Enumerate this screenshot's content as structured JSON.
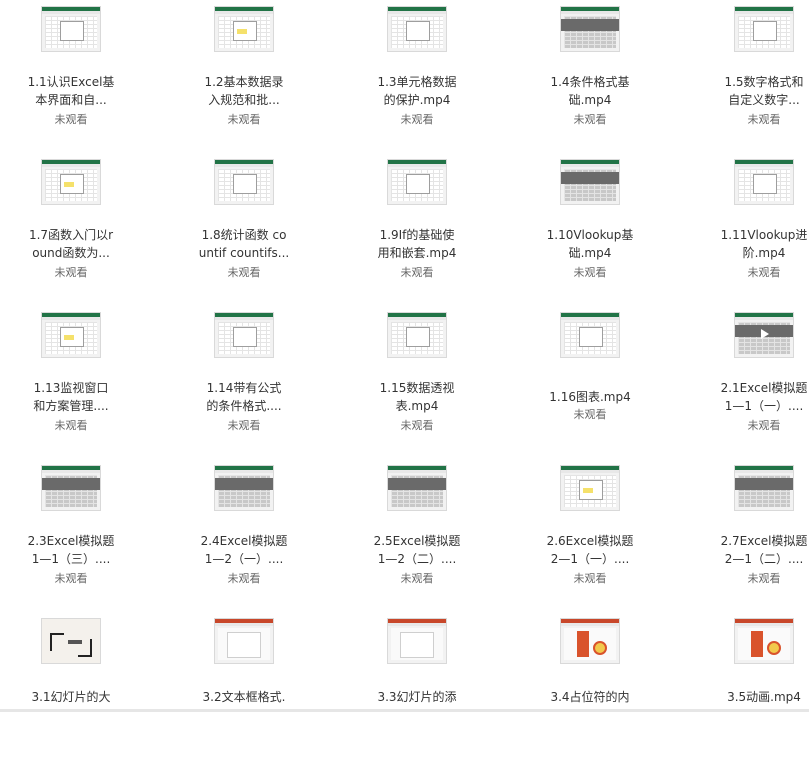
{
  "videos": [
    {
      "title": "1.1认识Excel基\n本界面和自...",
      "status": "未观看",
      "thumb": "excel-dialog"
    },
    {
      "title": "1.2基本数据录\n入规范和批...",
      "status": "未观看",
      "thumb": "excel-highlight"
    },
    {
      "title": "1.3单元格数据\n的保护.mp4",
      "status": "未观看",
      "thumb": "excel-dialog"
    },
    {
      "title": "1.4条件格式基\n础.mp4",
      "status": "未观看",
      "thumb": "excel-dark"
    },
    {
      "title": "1.5数字格式和\n自定义数字...",
      "status": "未观看",
      "thumb": "excel-dialog"
    },
    {
      "title": "1.7函数入门以r\nound函数为...",
      "status": "未观看",
      "thumb": "excel-highlight"
    },
    {
      "title": "1.8统计函数 co\nuntif countifs...",
      "status": "未观看",
      "thumb": "excel-dialog"
    },
    {
      "title": "1.9If的基础使\n用和嵌套.mp4",
      "status": "未观看",
      "thumb": "excel-dialog"
    },
    {
      "title": "1.10Vlookup基\n础.mp4",
      "status": "未观看",
      "thumb": "excel-dark"
    },
    {
      "title": "1.11Vlookup进\n阶.mp4",
      "status": "未观看",
      "thumb": "excel-dialog"
    },
    {
      "title": "1.13监视窗口\n和方案管理....",
      "status": "未观看",
      "thumb": "excel-highlight"
    },
    {
      "title": "1.14带有公式\n的条件格式....",
      "status": "未观看",
      "thumb": "excel-dialog"
    },
    {
      "title": "1.15数据透视\n表.mp4",
      "status": "未观看",
      "thumb": "excel-dialog"
    },
    {
      "title": "1.16图表.mp4",
      "status": "未观看",
      "thumb": "excel-dialog"
    },
    {
      "title": "2.1Excel模拟题\n1—1（一）....",
      "status": "未观看",
      "thumb": "excel-dark-play"
    },
    {
      "title": "2.3Excel模拟题\n1—1（三）....",
      "status": "未观看",
      "thumb": "excel-dark"
    },
    {
      "title": "2.4Excel模拟题\n1—2（一）....",
      "status": "未观看",
      "thumb": "excel-dark"
    },
    {
      "title": "2.5Excel模拟题\n1—2（二）....",
      "status": "未观看",
      "thumb": "excel-dark"
    },
    {
      "title": "2.6Excel模拟题\n2—1（一）....",
      "status": "未观看",
      "thumb": "excel-highlight"
    },
    {
      "title": "2.7Excel模拟题\n2—1（二）....",
      "status": "未观看",
      "thumb": "excel-dark"
    },
    {
      "title": "3.1幻灯片的大",
      "status": "",
      "thumb": "ppt-title"
    },
    {
      "title": "3.2文本框格式.",
      "status": "",
      "thumb": "ppt"
    },
    {
      "title": "3.3幻灯片的添",
      "status": "",
      "thumb": "ppt"
    },
    {
      "title": "3.4占位符的内",
      "status": "",
      "thumb": "ppt-red"
    },
    {
      "title": "3.5动画.mp4",
      "status": "",
      "thumb": "ppt-red"
    }
  ]
}
